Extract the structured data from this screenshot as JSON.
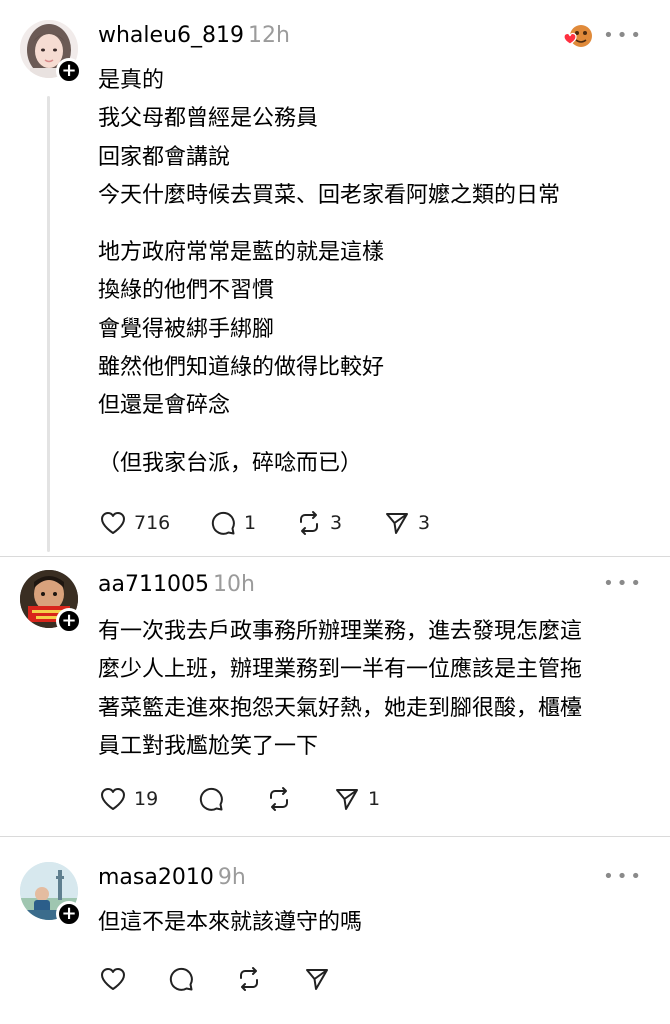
{
  "posts": [
    {
      "username": "whaleu6_819",
      "time": "12h",
      "lines1": [
        "是真的",
        "我父母都曾經是公務員",
        "回家都會講說",
        "今天什麼時候去買菜、回老家看阿嬤之類的日常"
      ],
      "lines2": [
        "地方政府常常是藍的就是這樣",
        "換綠的他們不習慣",
        "會覺得被綁手綁腳",
        "雖然他們知道綠的做得比較好",
        "但還是會碎念"
      ],
      "lines3": [
        "（但我家台派，碎唸而已）"
      ],
      "likes": "716",
      "replies": "1",
      "reposts": "3",
      "shares": "3"
    },
    {
      "username": "aa711005",
      "time": "10h",
      "lines": [
        "有一次我去戶政事務所辦理業務，進去發現怎麼這",
        "麼少人上班，辦理業務到一半有一位應該是主管拖",
        "著菜籃走進來抱怨天氣好熱，她走到腳很酸，櫃檯",
        "員工對我尷尬笑了一下"
      ],
      "likes": "19",
      "shares": "1"
    },
    {
      "username": "masa2010",
      "time": "9h",
      "lines": [
        "但這不是本來就該遵守的嗎"
      ]
    }
  ],
  "icons": {
    "like": "heart-icon",
    "reply": "comment-icon",
    "repost": "repost-icon",
    "share": "send-icon",
    "more": "more-icon",
    "follow": "plus-icon"
  },
  "colors": {
    "text": "#000000",
    "muted": "#9b9b9b",
    "divider": "#dadada",
    "thread_line": "#e3e3e3",
    "reaction_heart": "#ff3040"
  }
}
